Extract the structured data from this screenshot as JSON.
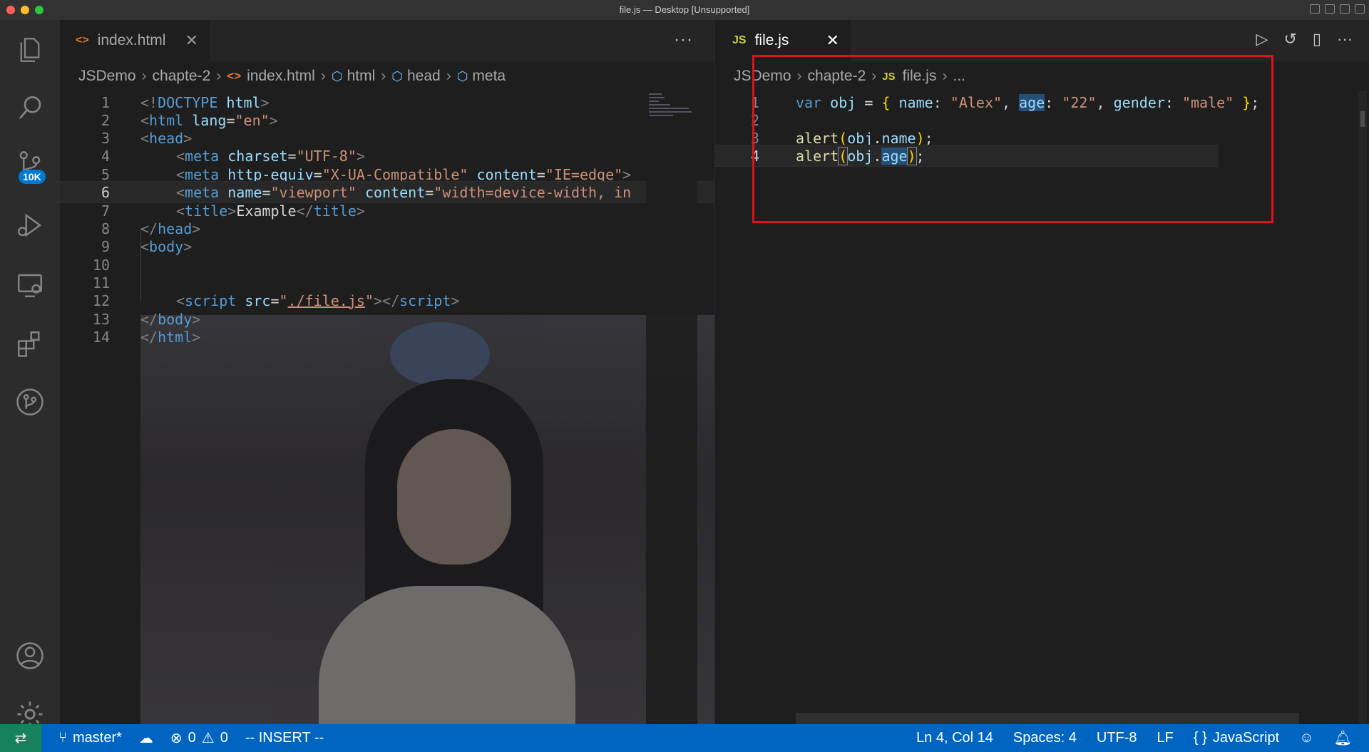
{
  "window": {
    "title": "file.js — Desktop [Unsupported]"
  },
  "activity": {
    "badge": "10K"
  },
  "left_editor": {
    "tab_label": "index.html",
    "breadcrumb": [
      "JSDemo",
      "chapte-2",
      "index.html",
      "html",
      "head",
      "meta"
    ],
    "lines": [
      {
        "n": "1"
      },
      {
        "n": "2"
      },
      {
        "n": "3"
      },
      {
        "n": "4"
      },
      {
        "n": "5"
      },
      {
        "n": "6"
      },
      {
        "n": "7"
      },
      {
        "n": "8"
      },
      {
        "n": "9"
      },
      {
        "n": "10"
      },
      {
        "n": "11"
      },
      {
        "n": "12"
      },
      {
        "n": "13"
      },
      {
        "n": "14"
      }
    ],
    "code": {
      "l1": [
        "<!",
        "DOCTYPE",
        " html",
        ">"
      ],
      "l2": [
        "<",
        "html",
        " lang",
        "=",
        "\"en\"",
        ">"
      ],
      "l3": [
        "<",
        "head",
        ">"
      ],
      "l4": [
        "<",
        "meta",
        " charset",
        "=",
        "\"UTF-8\"",
        ">"
      ],
      "l5": [
        "<",
        "meta",
        " http-equiv",
        "=",
        "\"X-UA-Compatible\"",
        " content",
        "=",
        "\"IE=edge\"",
        ">"
      ],
      "l6": [
        "<",
        "meta",
        " name",
        "=",
        "\"viewport\"",
        " content",
        "=",
        "\"width=device-width, in"
      ],
      "l7": [
        "<",
        "title",
        ">",
        "Example",
        "</",
        "title",
        ">"
      ],
      "l8": [
        "</",
        "head",
        ">"
      ],
      "l9": [
        "<",
        "body",
        ">"
      ],
      "l12": [
        "<",
        "script",
        " src",
        "=",
        "\"",
        "./file.js",
        "\"",
        "></",
        "script",
        ">"
      ],
      "l13": [
        "</",
        "body",
        ">"
      ],
      "l14": [
        "</",
        "html",
        ">"
      ]
    }
  },
  "right_editor": {
    "tab_label": "file.js",
    "breadcrumb": [
      "JSDemo",
      "chapte-2",
      "file.js",
      "..."
    ],
    "lines": [
      {
        "n": "1"
      },
      {
        "n": "2"
      },
      {
        "n": "3"
      },
      {
        "n": "4"
      }
    ],
    "code": {
      "l1": [
        "var",
        " obj",
        " = ",
        "{",
        " name",
        ": ",
        "\"Alex\"",
        ", ",
        "age",
        ": ",
        "\"22\"",
        ", ",
        "gender",
        ": ",
        "\"male\"",
        " ",
        "}",
        ";"
      ],
      "l3": [
        "alert",
        "(",
        "obj",
        ".",
        "name",
        ")",
        ";"
      ],
      "l4": [
        "alert",
        "(",
        "obj",
        ".",
        "age",
        ")",
        ";"
      ]
    }
  },
  "statusbar": {
    "branch": "master*",
    "errors": "0",
    "warnings": "0",
    "mode": "-- INSERT --",
    "position": "Ln 4, Col 14",
    "spaces": "Spaces: 4",
    "encoding": "UTF-8",
    "eol": "LF",
    "language": "JavaScript"
  },
  "colors": {
    "accent": "#0065c1",
    "remote": "#16825d",
    "highlight_box": "#e0101c"
  }
}
